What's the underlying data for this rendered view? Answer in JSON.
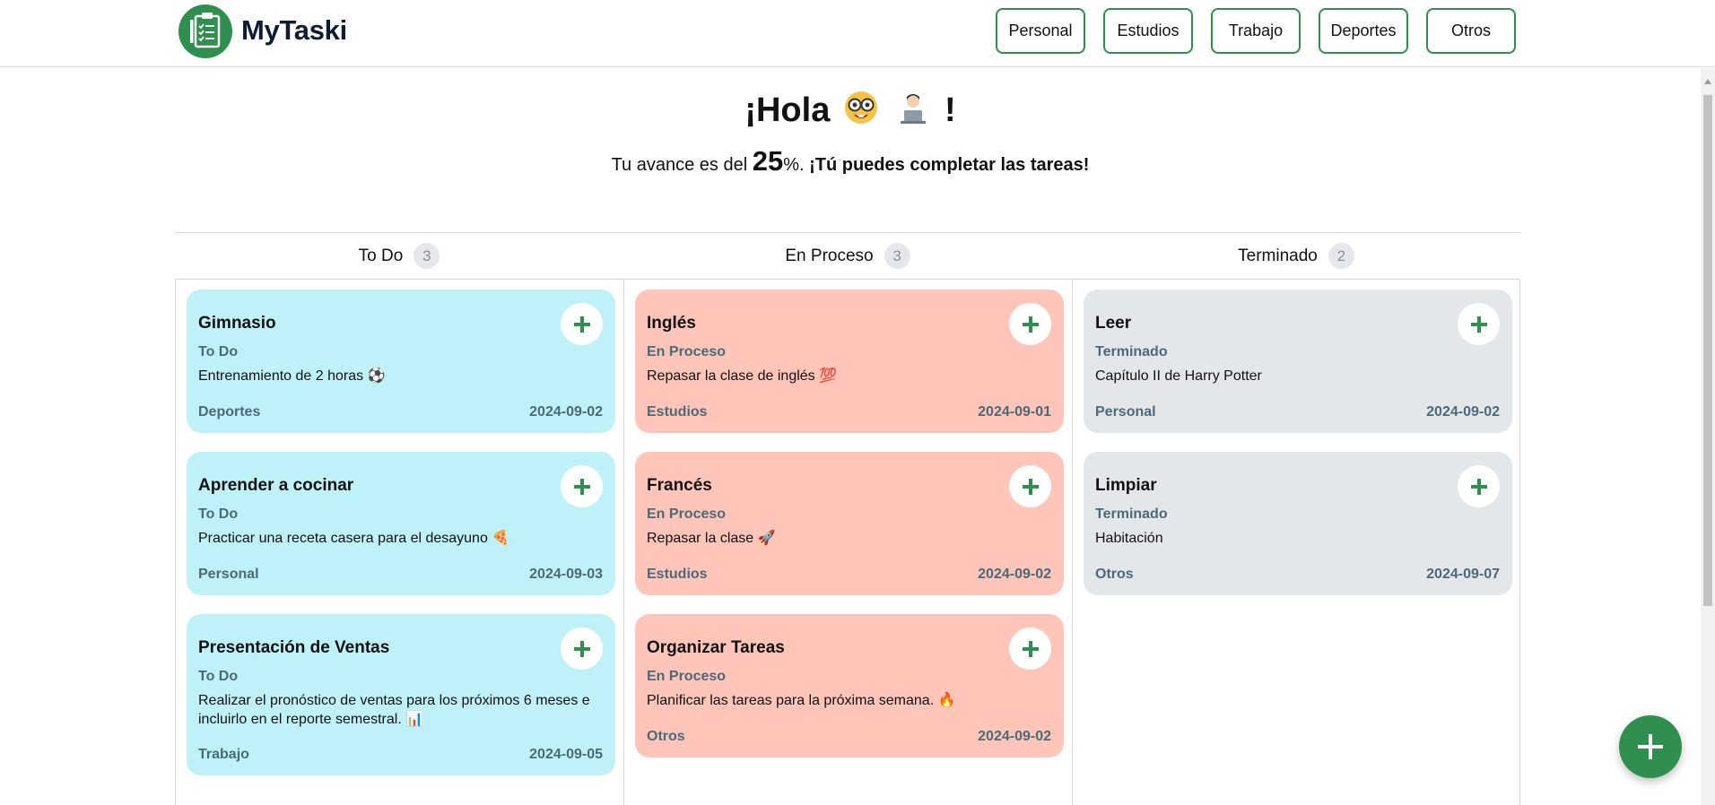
{
  "header": {
    "brand": "MyTaski",
    "nav": [
      "Personal",
      "Estudios",
      "Trabajo",
      "Deportes",
      "Otros"
    ]
  },
  "greeting": {
    "title": "¡Hola",
    "exclaim": "!",
    "emojis": [
      "nerd-face-icon",
      "technologist-icon"
    ],
    "progress_prefix": "Tu avance es del",
    "progress_value": "25",
    "progress_suffix": "%.",
    "cheer": "¡Tú puedes completar las tareas!"
  },
  "columns": [
    {
      "title": "To Do",
      "count": "3",
      "color": "#bff1f9",
      "cards": [
        {
          "title": "Gimnasio",
          "status": "To Do",
          "desc": "Entrenamiento de 2 horas ⚽",
          "category": "Deportes",
          "date": "2024-09-02"
        },
        {
          "title": "Aprender a cocinar",
          "status": "To Do",
          "desc": "Practicar una receta casera para el desayuno 🍕",
          "category": "Personal",
          "date": "2024-09-03"
        },
        {
          "title": "Presentación de Ventas",
          "status": "To Do",
          "desc": "Realizar el pronóstico de ventas para los próximos 6 meses e incluirlo en el reporte semestral. 📊",
          "category": "Trabajo",
          "date": "2024-09-05"
        }
      ]
    },
    {
      "title": "En Proceso",
      "count": "3",
      "color": "#fec5b8",
      "cards": [
        {
          "title": "Inglés",
          "status": "En Proceso",
          "desc": "Repasar la clase de inglés 💯",
          "category": "Estudios",
          "date": "2024-09-01"
        },
        {
          "title": "Francés",
          "status": "En Proceso",
          "desc": "Repasar la clase 🚀",
          "category": "Estudios",
          "date": "2024-09-02"
        },
        {
          "title": "Organizar Tareas",
          "status": "En Proceso",
          "desc": "Planificar las tareas para la próxima semana. 🔥",
          "category": "Otros",
          "date": "2024-09-02"
        }
      ]
    },
    {
      "title": "Terminado",
      "count": "2",
      "color": "#e4e7ea",
      "cards": [
        {
          "title": "Leer",
          "status": "Terminado",
          "desc": "Capítulo II de Harry Potter",
          "category": "Personal",
          "date": "2024-09-02"
        },
        {
          "title": "Limpiar",
          "status": "Terminado",
          "desc": "Habitación",
          "category": "Otros",
          "date": "2024-09-07"
        }
      ]
    }
  ],
  "accent_color": "#2f8f4e"
}
